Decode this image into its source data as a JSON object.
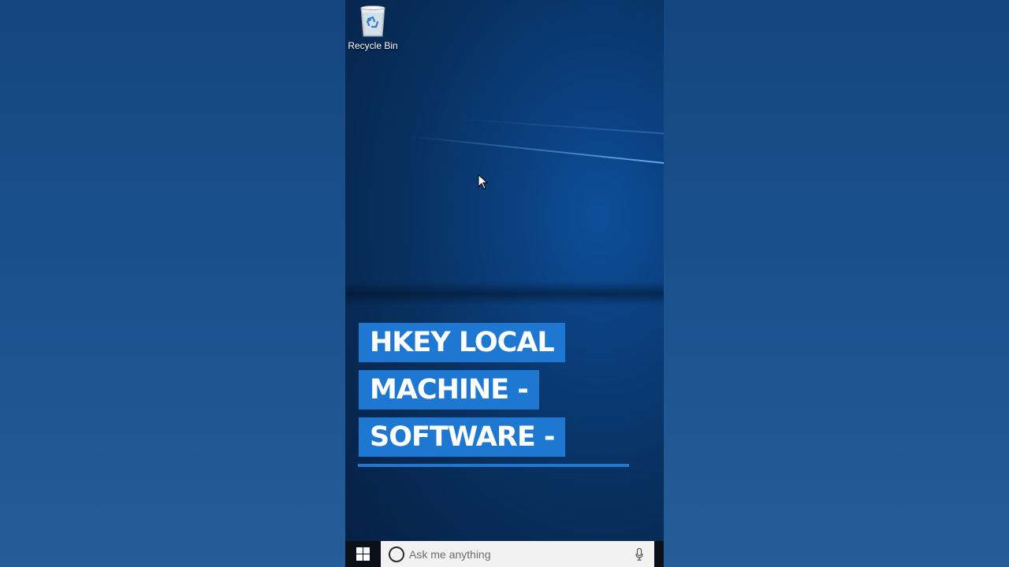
{
  "desktop": {
    "icons": [
      {
        "label": "Recycle Bin",
        "icon": "recycle-bin-icon"
      }
    ]
  },
  "caption": {
    "lines": [
      "HKEY LOCAL",
      "MACHINE -",
      "SOFTWARE -"
    ],
    "accent_color": "#1e78d2"
  },
  "taskbar": {
    "start_icon": "windows-logo-icon",
    "search_placeholder": "Ask me anything",
    "search_icon": "cortana-icon",
    "mic_icon": "microphone-icon"
  }
}
